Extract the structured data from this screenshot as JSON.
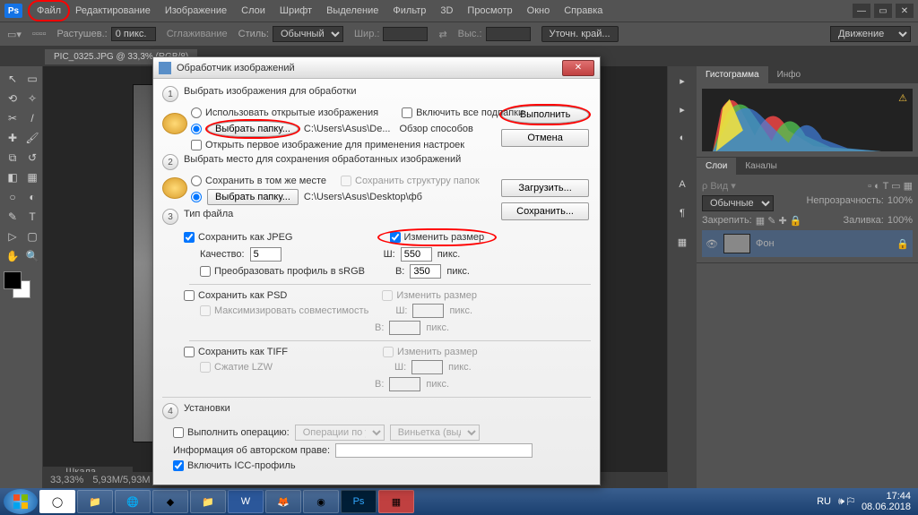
{
  "menubar": {
    "items": [
      "Файл",
      "Редактирование",
      "Изображение",
      "Слои",
      "Шрифт",
      "Выделение",
      "Фильтр",
      "3D",
      "Просмотр",
      "Окно",
      "Справка"
    ]
  },
  "options": {
    "feather_label": "Растушев.:",
    "feather_value": "0 пикс.",
    "antialias": "Сглаживание",
    "style_label": "Стиль:",
    "style_value": "Обычный",
    "width_label": "Шир.:",
    "height_label": "Выс.:",
    "refine": "Уточн. край...",
    "workspace": "Движение"
  },
  "document": {
    "tab": "PIC_0325.JPG @ 33,3% (RGB/8)"
  },
  "panels": {
    "histogram_tab": "Гистограмма",
    "info_tab": "Инфо",
    "layers_tab": "Слои",
    "channels_tab": "Каналы",
    "blend_mode": "Обычные",
    "opacity_label": "Непрозрачность:",
    "opacity_value": "100%",
    "lock_label": "Закрепить:",
    "fill_label": "Заливка:",
    "fill_value": "100%",
    "layer_name": "Фон"
  },
  "dialog": {
    "title": "Обработчик изображений",
    "run": "Выполнить",
    "cancel": "Отмена",
    "load": "Загрузить...",
    "save": "Сохранить...",
    "sec1_title": "Выбрать изображения для обработки",
    "use_open": "Использовать открытые изображения",
    "include_sub": "Включить все подпапки",
    "select_folder": "Выбрать папку...",
    "path1": "C:\\Users\\Asus\\De...",
    "browse": "Обзор способов",
    "open_first": "Открыть первое изображение для применения настроек",
    "sec2_title": "Выбрать место для сохранения обработанных изображений",
    "save_same": "Сохранить в том же месте",
    "keep_struct": "Сохранить структуру папок",
    "path2": "C:\\Users\\Asus\\Desktop\\фб",
    "sec3_title": "Тип файла",
    "save_jpeg": "Сохранить как JPEG",
    "resize": "Изменить размер",
    "quality_label": "Качество:",
    "quality_value": "5",
    "w_label": "Ш:",
    "w_value": "550",
    "h_label": "В:",
    "h_value": "350",
    "px": "пикс.",
    "convert_srgb": "Преобразовать профиль в sRGB",
    "save_psd": "Сохранить как PSD",
    "max_compat": "Максимизировать совместимость",
    "save_tiff": "Сохранить как TIFF",
    "lzw": "Сжатие LZW",
    "sec4_title": "Установки",
    "run_action": "Выполнить операцию:",
    "action_set": "Операции по умол...",
    "action_name": "Виньетка (выделен...",
    "copyright_label": "Информация об авторском праве:",
    "include_icc": "Включить ICC-профиль"
  },
  "timeline": {
    "label": "Шкала времени"
  },
  "status": {
    "zoom": "33,33%",
    "size": "5,93M/5,93M"
  },
  "tray": {
    "lang": "RU",
    "time": "17:44",
    "date": "08.06.2018"
  }
}
